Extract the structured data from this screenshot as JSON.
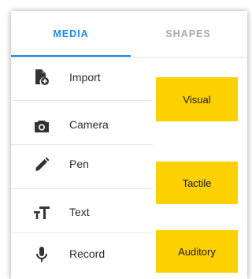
{
  "tabs": [
    {
      "label": "MEDIA",
      "active": true
    },
    {
      "label": "SHAPES",
      "active": false
    }
  ],
  "colors": {
    "accent": "#1e88e5",
    "sticky": "#fdd000"
  },
  "items": [
    {
      "label": "Import",
      "icon": "file-import-icon"
    },
    {
      "label": "Camera",
      "icon": "camera-icon"
    },
    {
      "label": "Pen",
      "icon": "pen-icon"
    },
    {
      "label": "Text",
      "icon": "text-size-icon"
    },
    {
      "label": "Record",
      "icon": "microphone-icon"
    }
  ],
  "stickies": [
    "Visual",
    "Tactile",
    "Auditory"
  ]
}
